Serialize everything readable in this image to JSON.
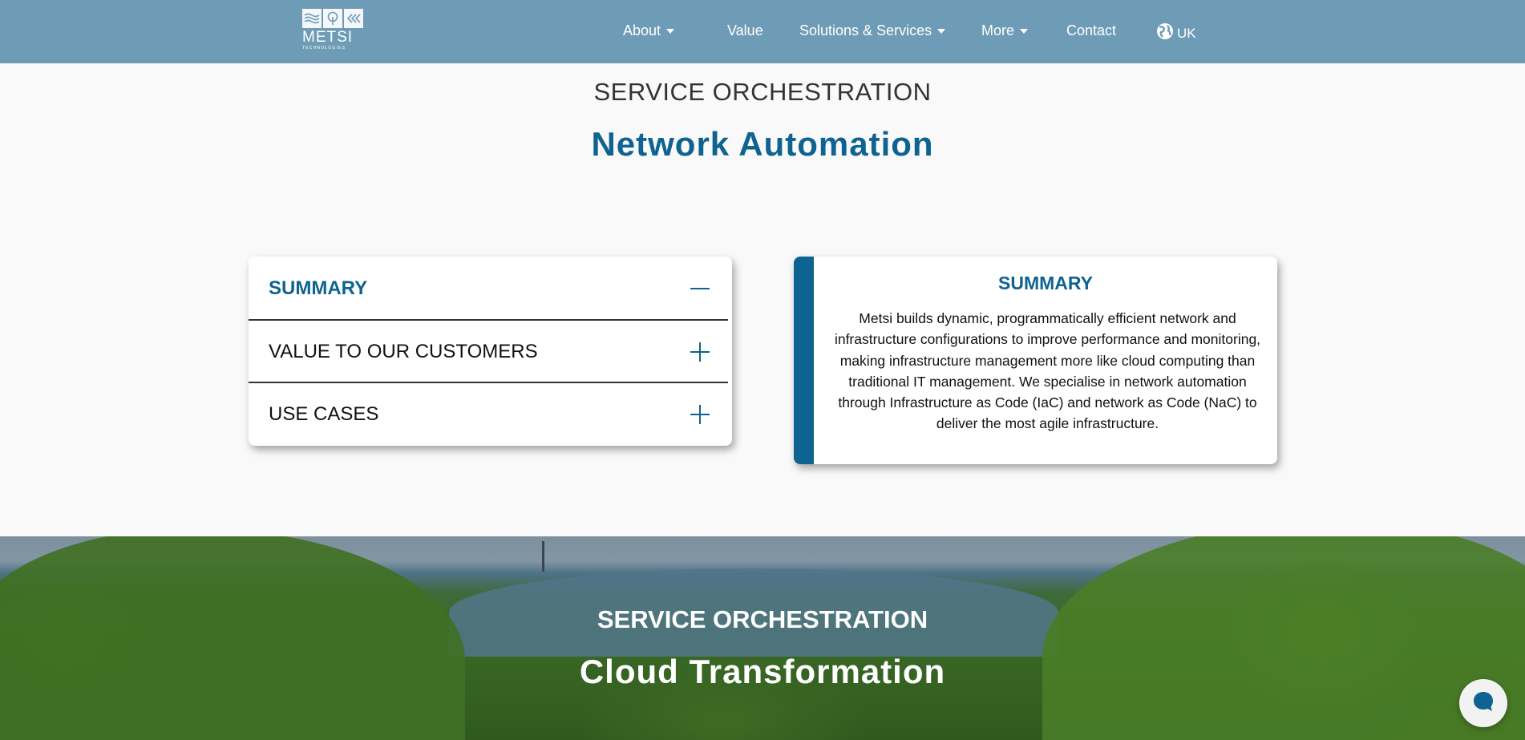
{
  "header": {
    "logo_text": "METSI",
    "logo_subtext": "TECHNOLOGIES",
    "nav": {
      "about": "About",
      "value": "Value",
      "solutions": "Solutions & Services",
      "more": "More",
      "contact": "Contact",
      "region": "UK"
    },
    "region_icon": "globe-icon",
    "dropdown_icon": "caret-down-icon"
  },
  "hero": {
    "eyebrow": "SERVICE ORCHESTRATION",
    "title": "Network Automation"
  },
  "accordion": {
    "items": [
      {
        "label": "SUMMARY",
        "expanded": true,
        "icon": "minus-icon"
      },
      {
        "label": "VALUE TO OUR CUSTOMERS",
        "expanded": false,
        "icon": "plus-icon"
      },
      {
        "label": "USE CASES",
        "expanded": false,
        "icon": "plus-icon"
      }
    ]
  },
  "panel": {
    "title": "SUMMARY",
    "body": "Metsi builds dynamic, programmatically efficient network and infrastructure configurations to improve performance and monitoring, making infrastructure management more like cloud computing than traditional IT management. We specialise in network automation through Infrastructure as Code (IaC) and network as Code (NaC) to deliver the most agile infrastructure."
  },
  "next_section": {
    "eyebrow": "SERVICE ORCHESTRATION",
    "title": "Cloud Transformation"
  },
  "chat_icon": "chat-bubble-icon",
  "colors": {
    "header_bg": "#6e9cb6",
    "accent": "#0e6390",
    "page_bg": "#f9f9f9"
  }
}
